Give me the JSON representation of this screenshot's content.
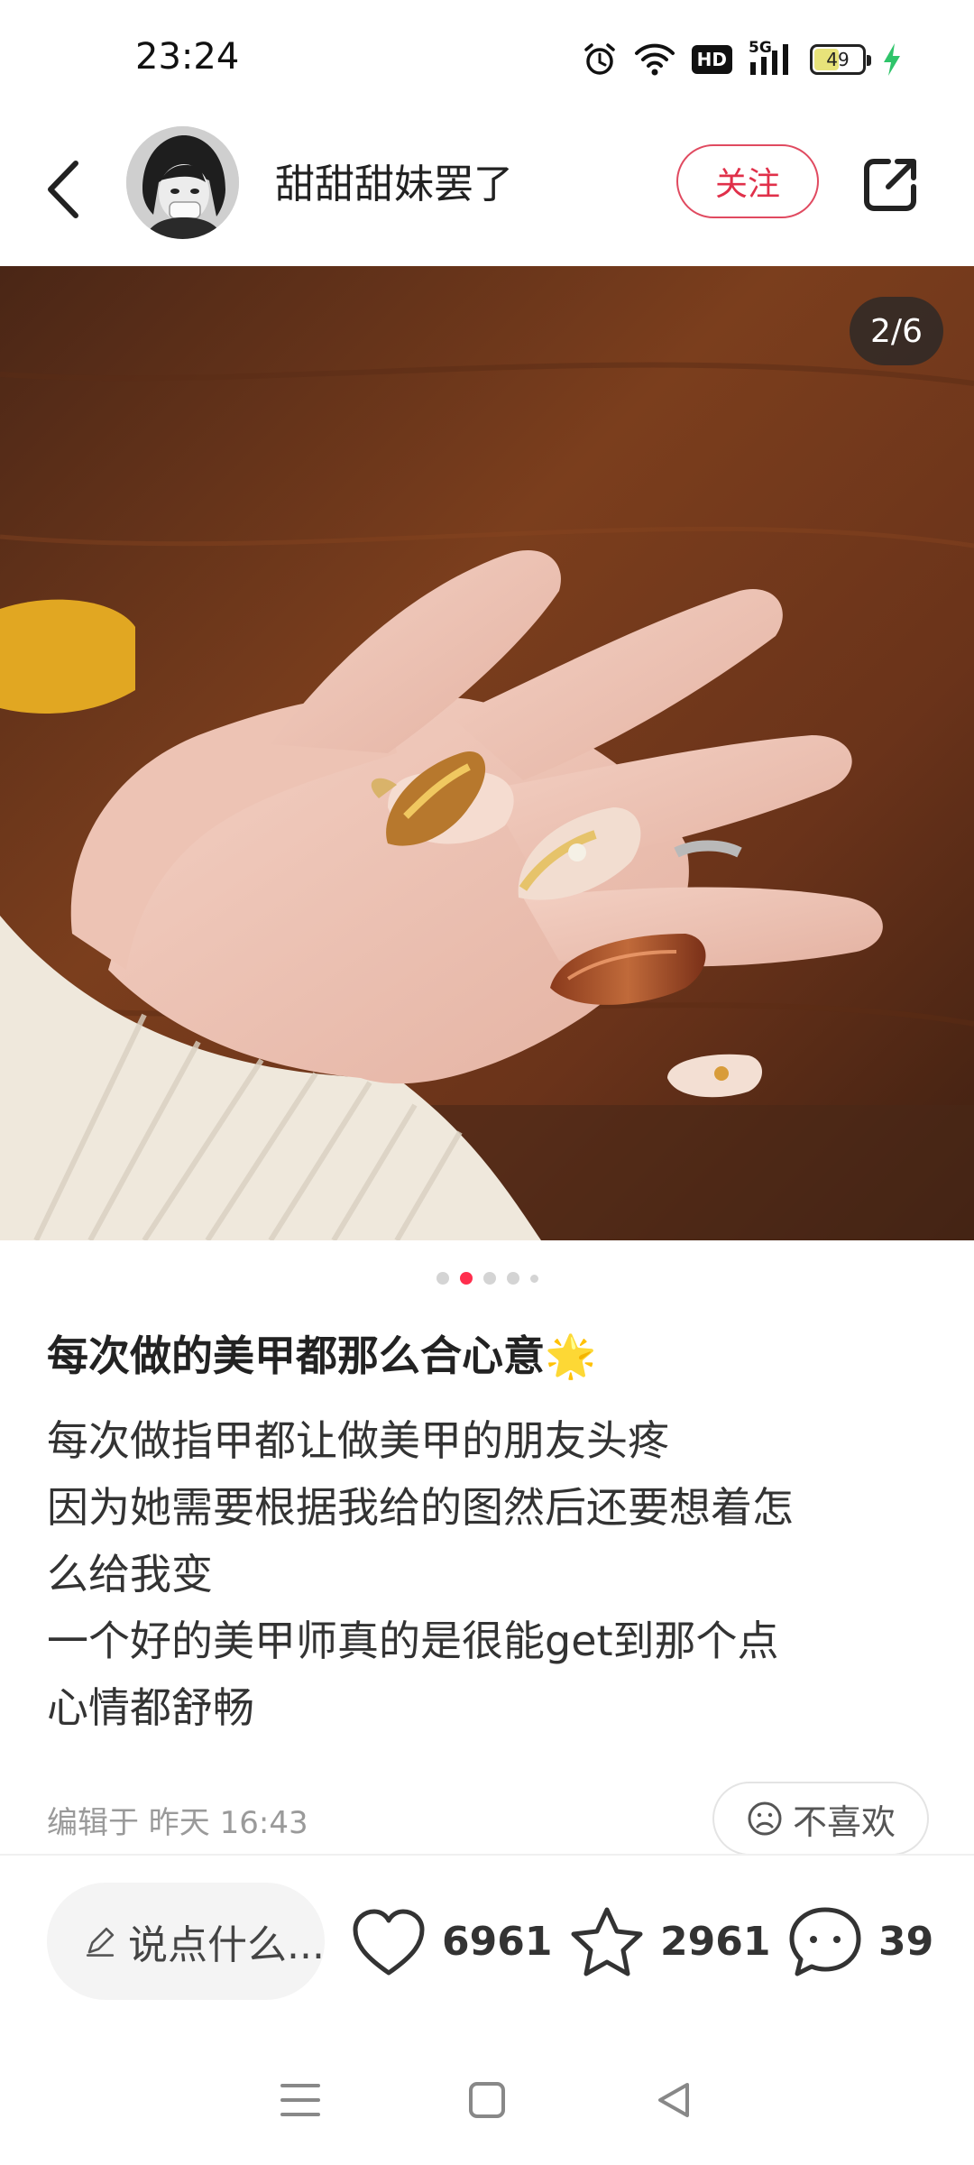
{
  "status_bar": {
    "time": "23:24",
    "network_label": "5G",
    "hd_label": "HD",
    "battery_level": "49",
    "icons": [
      "alarm-icon",
      "wifi-icon",
      "hd-icon",
      "signal-icon",
      "battery-icon",
      "charging-icon"
    ]
  },
  "header": {
    "username": "甜甜甜妹罢了",
    "follow_label": "关注",
    "icons": [
      "back-icon",
      "share-icon"
    ]
  },
  "photo": {
    "counter": "2/6",
    "current_index": 2,
    "total": 6
  },
  "post": {
    "title": "每次做的美甲都那么合心意",
    "title_emoji": "🌟",
    "body_lines": [
      "每次做指甲都让做美甲的朋友头疼",
      "因为她需要根据我给的图然后还要想着怎",
      "么给我变",
      "一个好的美甲师真的是很能get到那个点",
      "心情都舒畅"
    ],
    "edit_time": "编辑于 昨天 16:43",
    "dislike_label": "不喜欢"
  },
  "action_bar": {
    "comment_placeholder": "说点什么...",
    "likes": "6961",
    "collects": "2961",
    "comments": "39"
  },
  "colors": {
    "accent": "#ff2e4d",
    "follow_border": "#e04a60",
    "inactive_dot": "#d4d4d4"
  },
  "nav_bar": {
    "icons": [
      "menu-icon",
      "home-icon",
      "back-nav-icon"
    ]
  }
}
